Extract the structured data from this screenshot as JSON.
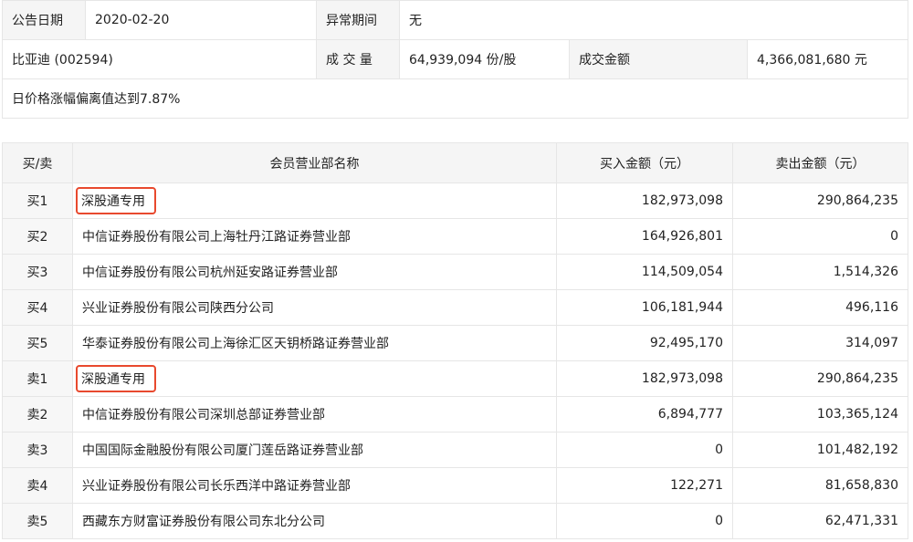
{
  "info": {
    "date_label": "公告日期",
    "date_value": "2020-02-20",
    "abnormal_label": "异常期间",
    "abnormal_value": "无",
    "stock": "比亚迪 (002594)",
    "volume_label": "成 交 量",
    "volume_value": "64,939,094 份/股",
    "amount_label": "成交金额",
    "amount_value": "4,366,081,680 元",
    "reason": "日价格涨幅偏离值达到7.87%"
  },
  "table": {
    "headers": {
      "side": "买/卖",
      "member": "会员营业部名称",
      "buy": "买入金额（元）",
      "sell": "卖出金额（元）"
    },
    "rows": [
      {
        "side": "买1",
        "member": "深股通专用",
        "buy": "182,973,098",
        "sell": "290,864,235"
      },
      {
        "side": "买2",
        "member": "中信证券股份有限公司上海牡丹江路证券营业部",
        "buy": "164,926,801",
        "sell": "0"
      },
      {
        "side": "买3",
        "member": "中信证券股份有限公司杭州延安路证券营业部",
        "buy": "114,509,054",
        "sell": "1,514,326"
      },
      {
        "side": "买4",
        "member": "兴业证券股份有限公司陕西分公司",
        "buy": "106,181,944",
        "sell": "496,116"
      },
      {
        "side": "买5",
        "member": "华泰证券股份有限公司上海徐汇区天钥桥路证券营业部",
        "buy": "92,495,170",
        "sell": "314,097"
      },
      {
        "side": "卖1",
        "member": "深股通专用",
        "buy": "182,973,098",
        "sell": "290,864,235"
      },
      {
        "side": "卖2",
        "member": "中信证券股份有限公司深圳总部证券营业部",
        "buy": "6,894,777",
        "sell": "103,365,124"
      },
      {
        "side": "卖3",
        "member": "中国国际金融股份有限公司厦门莲岳路证券营业部",
        "buy": "0",
        "sell": "101,482,192"
      },
      {
        "side": "卖4",
        "member": "兴业证券股份有限公司长乐西洋中路证券营业部",
        "buy": "122,271",
        "sell": "81,658,830"
      },
      {
        "side": "卖5",
        "member": "西藏东方财富证券股份有限公司东北分公司",
        "buy": "0",
        "sell": "62,471,331"
      }
    ]
  },
  "colors": {
    "highlight_border": "#e8492e",
    "label_bg": "#f5f5f5",
    "border": "#e6e6e6"
  }
}
